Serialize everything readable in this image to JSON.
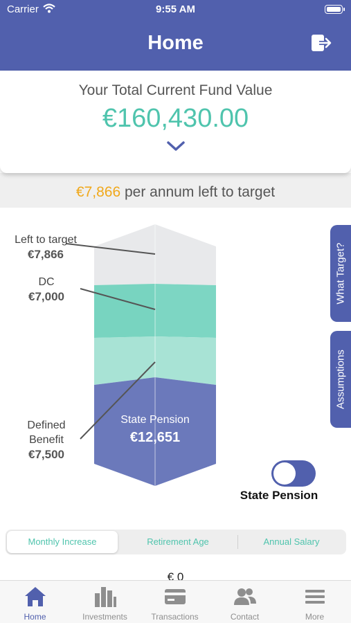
{
  "status_bar": {
    "carrier": "Carrier",
    "time": "9:55 AM"
  },
  "header": {
    "title": "Home",
    "logout_icon": "logout-icon"
  },
  "fund": {
    "label": "Your Total Current Fund Value",
    "value": "€160,430.00",
    "expand_icon": "chevron-down-icon"
  },
  "target": {
    "amount": "€7,866",
    "suffix": " per annum left to target"
  },
  "chart": {
    "left_to_target": {
      "label": "Left to target",
      "value": "€7,866"
    },
    "dc": {
      "label": "DC",
      "value": "€7,000"
    },
    "defined_benefit": {
      "label": "Defined\nBenefit",
      "value": "€7,500"
    },
    "state_pension": {
      "label": "State Pension",
      "value": "€12,651"
    }
  },
  "side_tabs": {
    "what_target": "What Target?",
    "assumptions": "Assumptions"
  },
  "toggle": {
    "label": "State Pension",
    "on": true
  },
  "segments": [
    "Monthly Increase",
    "Retirement Age",
    "Annual Salary"
  ],
  "zero_value": "€ 0",
  "tabs": [
    {
      "label": "Home",
      "icon": "home-icon"
    },
    {
      "label": "Investments",
      "icon": "bar-chart-icon"
    },
    {
      "label": "Transactions",
      "icon": "card-icon"
    },
    {
      "label": "Contact",
      "icon": "contacts-icon"
    },
    {
      "label": "More",
      "icon": "menu-icon"
    }
  ],
  "colors": {
    "primary": "#5160ad",
    "accent": "#4fc4ad",
    "highlight": "#f0a81b"
  }
}
